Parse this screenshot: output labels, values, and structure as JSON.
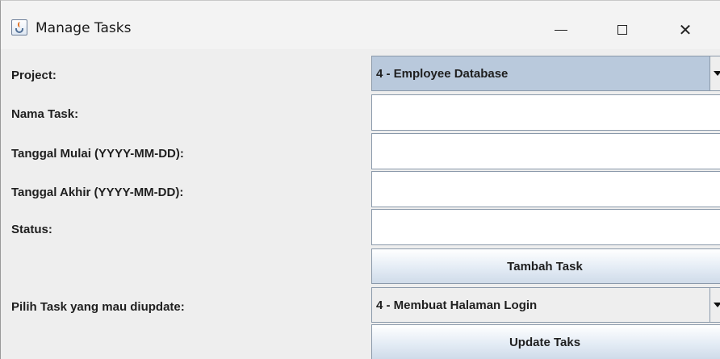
{
  "window": {
    "title": "Manage Tasks",
    "app_icon": "java-cup-icon",
    "controls": {
      "minimize": "minimize-icon",
      "maximize": "maximize-icon",
      "close": "close-icon",
      "close_glyph": "✕"
    }
  },
  "form": {
    "project_label": "Project:",
    "project_value": "4 - Employee Database",
    "nama_task_label": "Nama Task:",
    "nama_task_value": "",
    "tanggal_mulai_label": "Tanggal Mulai (YYYY-MM-DD):",
    "tanggal_mulai_value": "",
    "tanggal_akhir_label": "Tanggal Akhir (YYYY-MM-DD):",
    "tanggal_akhir_value": "",
    "status_label": "Status:",
    "status_value": "",
    "tambah_button": "Tambah Task",
    "pilih_task_label": "Pilih Task yang mau diupdate:",
    "pilih_task_value": "4 - Membuat Halaman Login",
    "update_button": "Update Taks"
  },
  "colors": {
    "window_bg": "#eeeeee",
    "selected_combo_bg": "#b9c9dc",
    "border": "#8a99aa"
  }
}
